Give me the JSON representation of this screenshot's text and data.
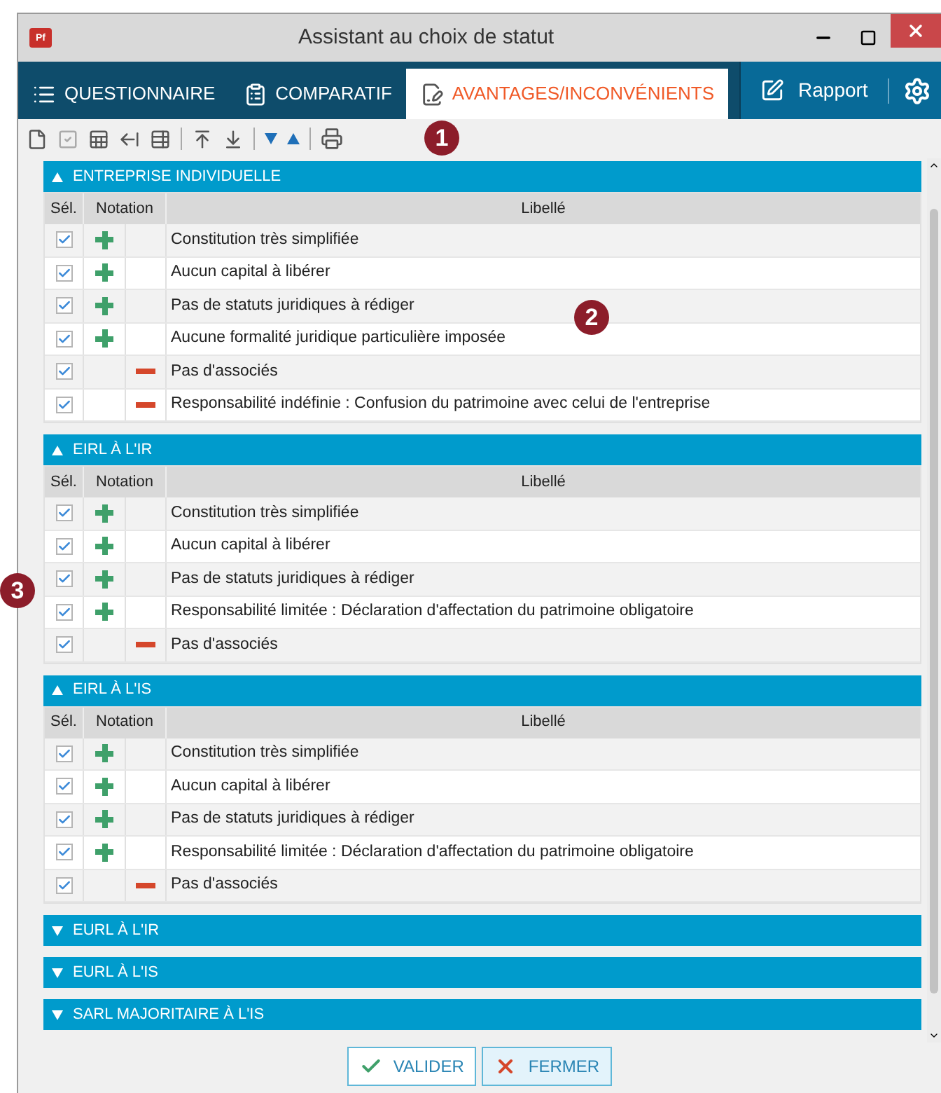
{
  "window": {
    "title": "Assistant au choix de statut",
    "logo": "Pf"
  },
  "tabs": [
    {
      "label": "QUESTIONNAIRE",
      "kind": "list",
      "selected": false
    },
    {
      "label": "COMPARATIF",
      "kind": "clipboard",
      "selected": false
    },
    {
      "label": "AVANTAGES/INCONVÉNIENTS",
      "kind": "edit",
      "selected": true
    }
  ],
  "report_button": {
    "label": "Rapport"
  },
  "sections": [
    {
      "title": "ENTREPRISE INDIVIDUELLE",
      "expanded": true,
      "columns": {
        "sel": "Sél.",
        "notation": "Notation",
        "label": "Libellé"
      },
      "rows": [
        {
          "checked": true,
          "kind": "plus",
          "label": "Constitution très simplifiée"
        },
        {
          "checked": true,
          "kind": "plus",
          "label": "Aucun capital à libérer"
        },
        {
          "checked": true,
          "kind": "plus",
          "label": "Pas de statuts juridiques à rédiger"
        },
        {
          "checked": true,
          "kind": "plus",
          "label": "Aucune formalité juridique particulière imposée"
        },
        {
          "checked": true,
          "kind": "minus",
          "label": "Pas d'associés"
        },
        {
          "checked": true,
          "kind": "minus",
          "label": "Responsabilité indéfinie : Confusion du patrimoine avec celui de l'entreprise"
        }
      ]
    },
    {
      "title": "EIRL À L'IR",
      "expanded": true,
      "columns": {
        "sel": "Sél.",
        "notation": "Notation",
        "label": "Libellé"
      },
      "rows": [
        {
          "checked": true,
          "kind": "plus",
          "label": "Constitution très simplifiée"
        },
        {
          "checked": true,
          "kind": "plus",
          "label": "Aucun capital à libérer"
        },
        {
          "checked": true,
          "kind": "plus",
          "label": "Pas de statuts juridiques à rédiger"
        },
        {
          "checked": true,
          "kind": "plus",
          "label": "Responsabilité limitée : Déclaration d'affectation du patrimoine obligatoire"
        },
        {
          "checked": true,
          "kind": "minus",
          "label": "Pas d'associés"
        }
      ]
    },
    {
      "title": "EIRL À L'IS",
      "expanded": true,
      "columns": {
        "sel": "Sél.",
        "notation": "Notation",
        "label": "Libellé"
      },
      "rows": [
        {
          "checked": true,
          "kind": "plus",
          "label": "Constitution très simplifiée"
        },
        {
          "checked": true,
          "kind": "plus",
          "label": "Aucun capital à libérer"
        },
        {
          "checked": true,
          "kind": "plus",
          "label": "Pas de statuts juridiques à rédiger"
        },
        {
          "checked": true,
          "kind": "plus",
          "label": "Responsabilité limitée : Déclaration d'affectation du patrimoine obligatoire"
        },
        {
          "checked": true,
          "kind": "minus",
          "label": "Pas d'associés"
        }
      ]
    },
    {
      "title": "EURL À L'IR",
      "expanded": false
    },
    {
      "title": "EURL À L'IS",
      "expanded": false
    },
    {
      "title": "SARL MAJORITAIRE À L'IS",
      "expanded": false
    }
  ],
  "buttons": [
    {
      "label": "VALIDER",
      "kind": "ok"
    },
    {
      "label": "FERMER",
      "kind": "close"
    }
  ],
  "callouts": [
    {
      "text": "1",
      "kind": "toolbar"
    },
    {
      "text": "2",
      "kind": "table"
    },
    {
      "text": "3",
      "kind": "checkbox"
    }
  ]
}
